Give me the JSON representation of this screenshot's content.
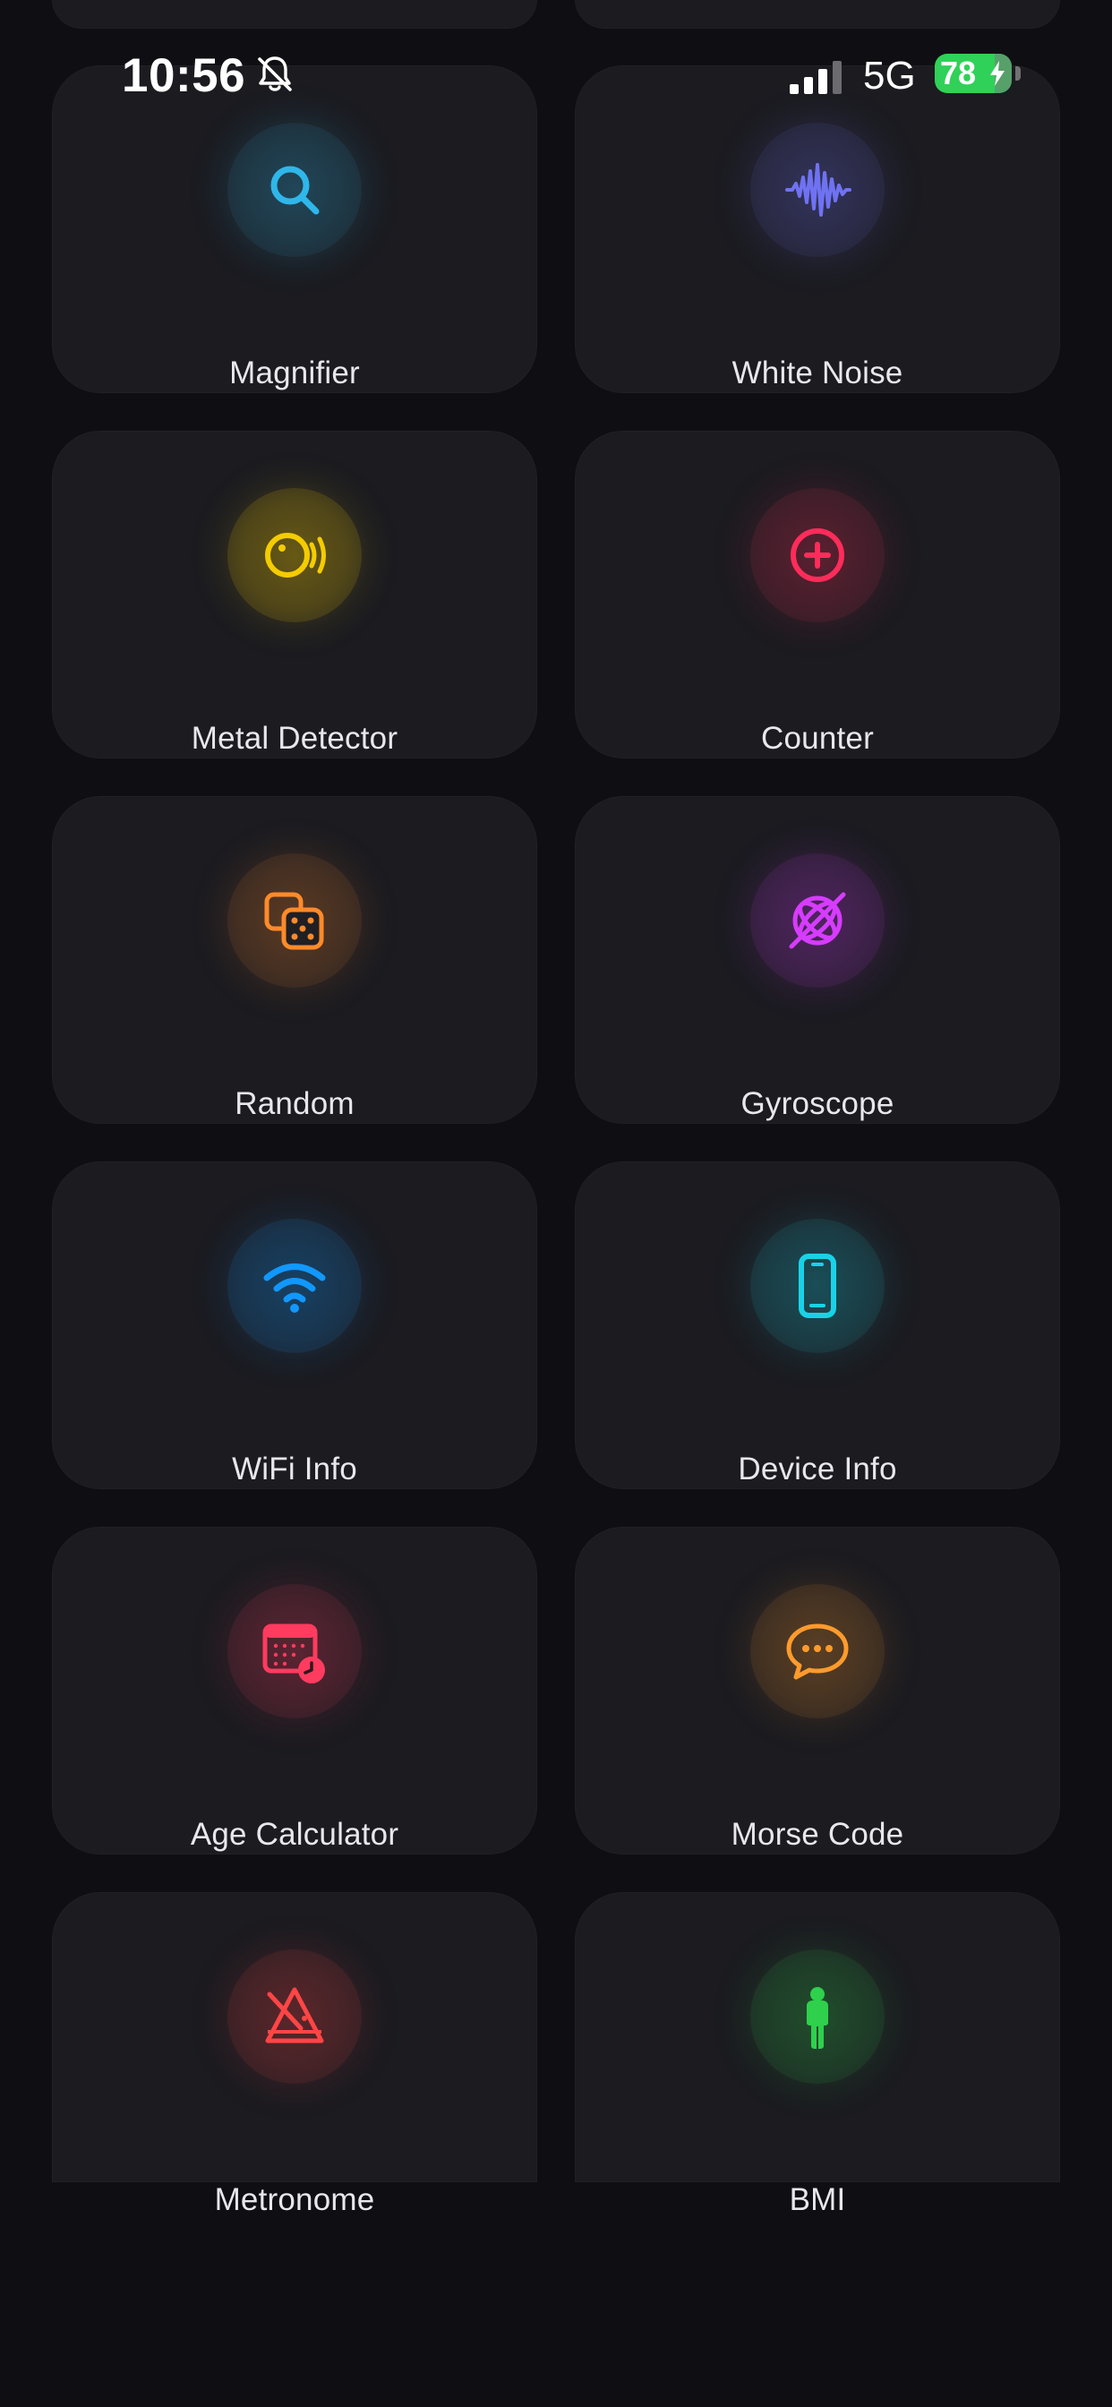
{
  "status_bar": {
    "time": "10:56",
    "network": "5G",
    "battery_percent": "78",
    "battery_level": 0.78,
    "icons": [
      "bell-slash-icon",
      "signal-bars-icon",
      "charging-bolt-icon"
    ]
  },
  "tools": [
    {
      "label": "Magnifier",
      "icon": "magnifier-icon",
      "color": "#2fb7ea"
    },
    {
      "label": "White Noise",
      "icon": "waveform-icon",
      "color": "#6f72f2"
    },
    {
      "label": "Metal Detector",
      "icon": "metal-detector-icon",
      "color": "#f4cc00"
    },
    {
      "label": "Counter",
      "icon": "plus-circle-icon",
      "color": "#ff2c5a"
    },
    {
      "label": "Random",
      "icon": "dice-icon",
      "color": "#ff8a2a"
    },
    {
      "label": "Gyroscope",
      "icon": "gyroscope-icon",
      "color": "#d63cff"
    },
    {
      "label": "WiFi Info",
      "icon": "wifi-icon",
      "color": "#1198ff"
    },
    {
      "label": "Device Info",
      "icon": "phone-icon",
      "color": "#19d2e7"
    },
    {
      "label": "Age Calculator",
      "icon": "calendar-clock-icon",
      "color": "#ff3b5f"
    },
    {
      "label": "Morse Code",
      "icon": "speech-bubble-icon",
      "color": "#ff9b2c"
    },
    {
      "label": "Metronome",
      "icon": "metronome-icon",
      "color": "#ff4545"
    },
    {
      "label": "BMI",
      "icon": "person-icon",
      "color": "#2ed04c"
    }
  ]
}
